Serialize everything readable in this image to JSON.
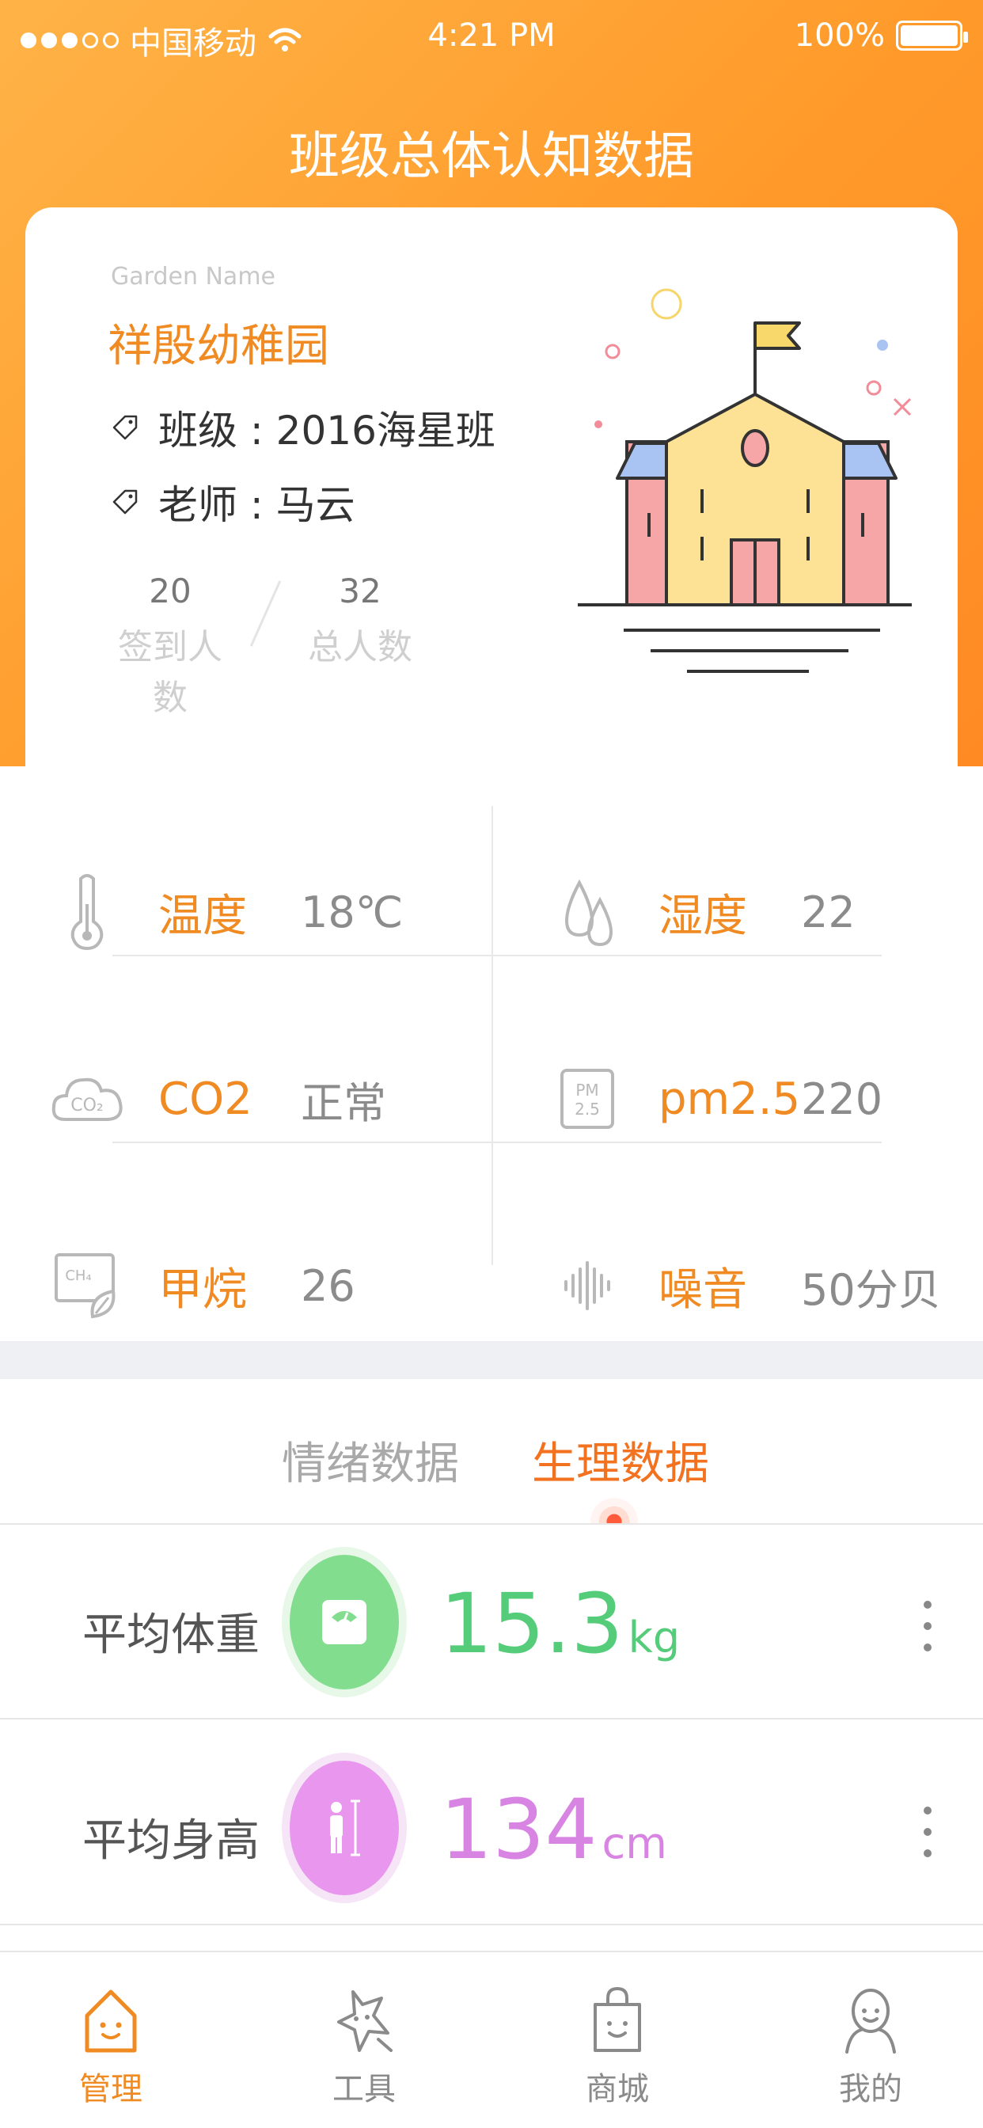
{
  "status_bar": {
    "carrier": "中国移动",
    "time": "4:21 PM",
    "battery": "100%"
  },
  "page": {
    "title": "班级总体认知数据"
  },
  "garden": {
    "caption": "Garden Name",
    "name": "祥殷幼稚园",
    "class_line": "班级 : 2016海星班",
    "teacher_line": "老师 : 马云",
    "checked_in": "20",
    "checked_in_label": "签到人数",
    "total": "32",
    "total_label": "总人数"
  },
  "environment": [
    {
      "label": "温度",
      "value": "18℃",
      "icon": "thermometer-icon"
    },
    {
      "label": "湿度",
      "value": "22",
      "icon": "water-drops-icon"
    },
    {
      "label": "CO2",
      "value": "正常",
      "icon": "co2-cloud-icon"
    },
    {
      "label": "pm2.5",
      "value": "220",
      "icon": "pm25-icon"
    },
    {
      "label": "甲烷",
      "value": "26",
      "icon": "methane-icon"
    },
    {
      "label": "噪音",
      "value": "50分贝",
      "icon": "sound-wave-icon"
    }
  ],
  "tabs": {
    "emotion": "情绪数据",
    "physiology": "生理数据",
    "active": "physiology"
  },
  "metrics": [
    {
      "label": "平均体重",
      "value": "15.3",
      "unit": "kg",
      "icon": "scale-icon",
      "color": "#55cc7a"
    },
    {
      "label": "平均身高",
      "value": "134",
      "unit": "cm",
      "icon": "height-ruler-icon",
      "color": "#d884e3"
    }
  ],
  "tabbar": [
    {
      "label": "管理",
      "icon": "home-icon",
      "active": true
    },
    {
      "label": "工具",
      "icon": "tools-star-icon",
      "active": false
    },
    {
      "label": "商城",
      "icon": "shopping-bag-icon",
      "active": false
    },
    {
      "label": "我的",
      "icon": "profile-icon",
      "active": false
    }
  ],
  "colors": {
    "accent": "#f08a22",
    "header_start": "#ffb347",
    "header_end": "#ff8a24",
    "active_tab": "#f2721f"
  }
}
